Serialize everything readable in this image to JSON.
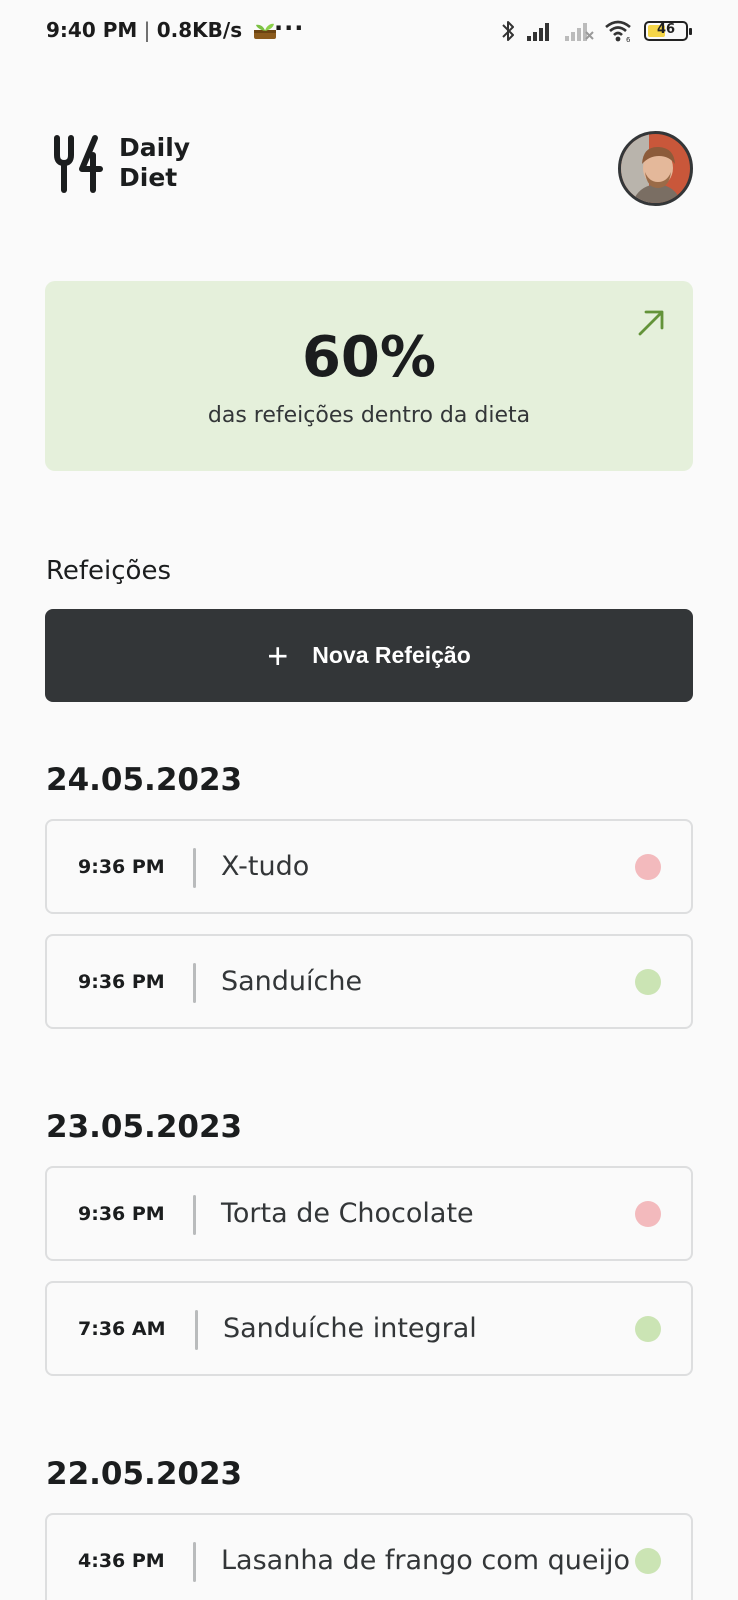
{
  "status_bar": {
    "time": "9:40 PM",
    "net_speed": "0.8KB/s",
    "battery_level": "46",
    "battery_percent": 46
  },
  "header": {
    "logo_line1": "Daily",
    "logo_line2": "Diet"
  },
  "stats": {
    "percent": "60%",
    "caption": "das refeições dentro da dieta",
    "background_color": "#E5F0DB",
    "arrow_color": "#639339"
  },
  "meals": {
    "title": "Refeições",
    "new_meal_label": "Nova Refeição",
    "colors": {
      "in_diet": "#CBE4B4",
      "off_diet": "#F3BABD"
    },
    "days": [
      {
        "date": "24.05.2023",
        "items": [
          {
            "time": "9:36 PM",
            "name": "X-tudo",
            "in_diet": false
          },
          {
            "time": "9:36 PM",
            "name": "Sanduíche",
            "in_diet": true
          }
        ]
      },
      {
        "date": "23.05.2023",
        "items": [
          {
            "time": "9:36 PM",
            "name": "Torta de Chocolate",
            "in_diet": false
          },
          {
            "time": "7:36 AM",
            "name": "Sanduíche integral",
            "in_diet": true
          }
        ]
      },
      {
        "date": "22.05.2023",
        "items": [
          {
            "time": "4:36 PM",
            "name": "Lasanha de frango com queijo",
            "in_diet": true
          }
        ]
      }
    ]
  }
}
